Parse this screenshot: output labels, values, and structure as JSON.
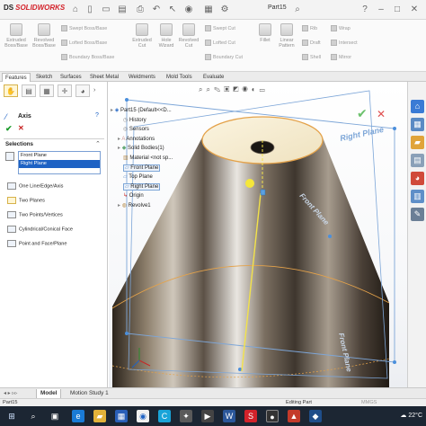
{
  "app": {
    "brand_prefix": "DS",
    "brand": "SOLIDWORKS",
    "document": "Part15"
  },
  "ribbon": {
    "large": [
      {
        "label": "Extruded\nBoss/Base"
      },
      {
        "label": "Revolved\nBoss/Base"
      },
      {
        "label": "Extruded\nCut"
      },
      {
        "label": "Hole\nWizard"
      },
      {
        "label": "Revolved\nCut"
      },
      {
        "label": "Fillet"
      },
      {
        "label": "Linear\nPattern"
      },
      {
        "label": "Rib"
      },
      {
        "label": "Draft"
      },
      {
        "label": "Shell"
      },
      {
        "label": "Wrap"
      },
      {
        "label": "Intersect"
      },
      {
        "label": "Mirror"
      }
    ],
    "small": [
      "Swept Boss/Base",
      "Lofted Boss/Base",
      "Boundary Boss/Base",
      "Swept Cut",
      "Lofted Cut",
      "Boundary Cut"
    ]
  },
  "tabs": [
    "Features",
    "Sketch",
    "Surfaces",
    "Sheet Metal",
    "Weldments",
    "Mold Tools",
    "Evaluate"
  ],
  "property_manager": {
    "title": "Axis",
    "help": "?",
    "selections_header": "Selections",
    "selected_items": [
      "Front Plane",
      "Right Plane"
    ],
    "options": [
      "One Line/Edge/Axis",
      "Two Planes",
      "Two Points/Vertices",
      "Cylindrical/Conical Face",
      "Point and Face/Plane"
    ]
  },
  "tree": {
    "root": "Part15  (Default<<D...",
    "items": [
      "History",
      "Sensors",
      "Annotations",
      "Solid Bodies(1)",
      "Material <not sp...",
      "Front Plane",
      "Top Plane",
      "Right Plane",
      "Origin",
      "Revolve1"
    ]
  },
  "viewport_labels": {
    "right_plane": "Right Plane",
    "front_plane": "Front Plane"
  },
  "bottom_tabs": [
    "Model",
    "Motion Study 1"
  ],
  "status": {
    "doc": "Part15",
    "mode": "Editing Part",
    "units": "MMGS"
  },
  "taskbar": {
    "temperature": "22°C"
  },
  "colors": {
    "accent": "#1e62c4",
    "brand": "#d3222a",
    "plane_blue": "#7da6d8",
    "edge_orange": "#e4a24a"
  }
}
